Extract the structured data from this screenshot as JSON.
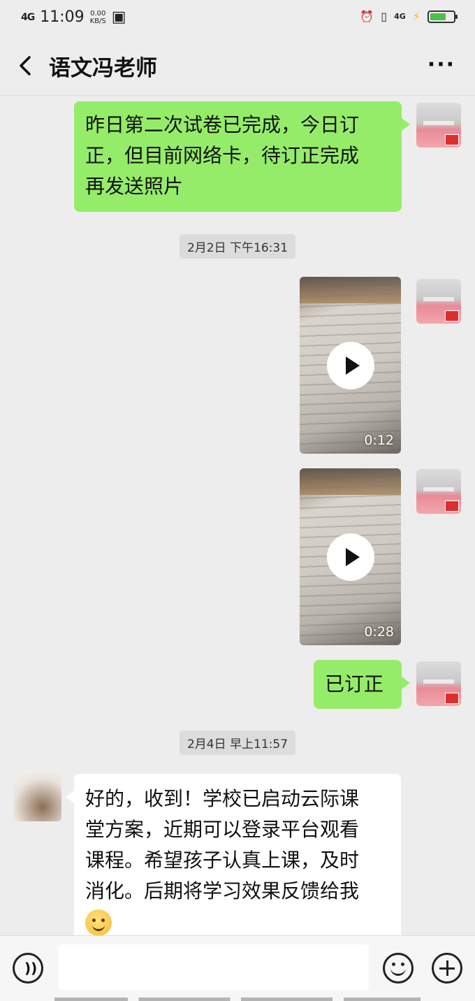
{
  "status_bar": {
    "signal": "4G",
    "time": "11:09",
    "speed": "0.00",
    "speed_unit": "KB/S",
    "network": "4G"
  },
  "header": {
    "title": "语文冯老师",
    "more_label": "···"
  },
  "messages": [
    {
      "sender": "me",
      "type": "text",
      "lines": [
        "昨日第二次试卷已完成，今日订",
        "正，但目前网络卡，待订正完成",
        "再发送照片"
      ]
    },
    {
      "type": "timestamp",
      "text": "2月2日 下午16:31"
    },
    {
      "sender": "me",
      "type": "video",
      "duration": "0:12"
    },
    {
      "sender": "me",
      "type": "video",
      "duration": "0:28"
    },
    {
      "sender": "me",
      "type": "text",
      "lines": [
        "已订正"
      ]
    },
    {
      "type": "timestamp",
      "text": "2月4日 早上11:57"
    },
    {
      "sender": "other",
      "type": "text",
      "lines": [
        "好的，收到！学校已启动云际课",
        "堂方案，近期可以登录平台观看",
        "课程。希望孩子认真上课，及时",
        "消化。后期将学习效果反馈给我"
      ],
      "emoji": "smile-emoji"
    }
  ],
  "input_bar": {
    "voice_icon": "voice-icon",
    "emoji_icon": "emoji-icon",
    "plus_icon": "plus-icon"
  },
  "colors": {
    "background": "#ededed",
    "my_bubble": "#95ec69",
    "other_bubble": "#ffffff",
    "battery": "#4cc04c"
  }
}
